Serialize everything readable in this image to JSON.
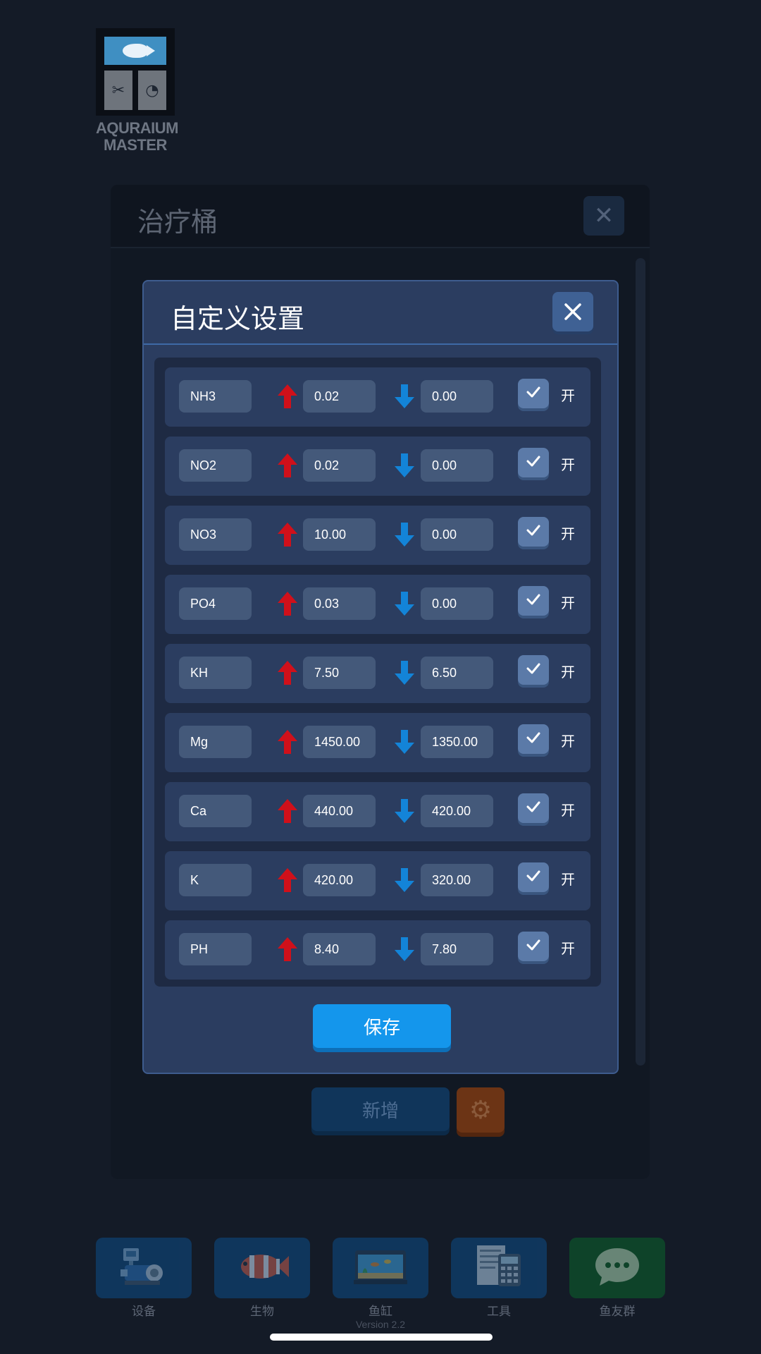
{
  "logo": {
    "line1": "AQURAIUM",
    "line2": "MASTER"
  },
  "background_panel": {
    "title": "治疗桶",
    "add_label": "新增"
  },
  "dialog": {
    "title": "自定义设置",
    "save_label": "保存",
    "rows": [
      {
        "name": "NH3",
        "upper": "0.02",
        "lower": "0.00",
        "on_label": "开",
        "checked": true
      },
      {
        "name": "NO2",
        "upper": "0.02",
        "lower": "0.00",
        "on_label": "开",
        "checked": true
      },
      {
        "name": "NO3",
        "upper": "10.00",
        "lower": "0.00",
        "on_label": "开",
        "checked": true
      },
      {
        "name": "PO4",
        "upper": "0.03",
        "lower": "0.00",
        "on_label": "开",
        "checked": true
      },
      {
        "name": "KH",
        "upper": "7.50",
        "lower": "6.50",
        "on_label": "开",
        "checked": true
      },
      {
        "name": "Mg",
        "upper": "1450.00",
        "lower": "1350.00",
        "on_label": "开",
        "checked": true
      },
      {
        "name": "Ca",
        "upper": "440.00",
        "lower": "420.00",
        "on_label": "开",
        "checked": true
      },
      {
        "name": "K",
        "upper": "420.00",
        "lower": "320.00",
        "on_label": "开",
        "checked": true
      },
      {
        "name": "PH",
        "upper": "8.40",
        "lower": "7.80",
        "on_label": "开",
        "checked": true
      }
    ]
  },
  "nav": [
    {
      "label": "设备",
      "icon": "equipment-icon",
      "color": "#0f3b66"
    },
    {
      "label": "生物",
      "icon": "clownfish-icon",
      "color": "#0f3b66"
    },
    {
      "label": "鱼缸",
      "icon": "fish-tank-icon",
      "color": "#0f3b66"
    },
    {
      "label": "工具",
      "icon": "calculator-icon",
      "color": "#0f3b66"
    },
    {
      "label": "鱼友群",
      "icon": "chat-icon",
      "color": "#0d4a2a"
    }
  ],
  "version": "Version 2.2",
  "colors": {
    "up_arrow": "#d0101a",
    "down_arrow": "#1384d8",
    "accent": "#1496ec"
  }
}
